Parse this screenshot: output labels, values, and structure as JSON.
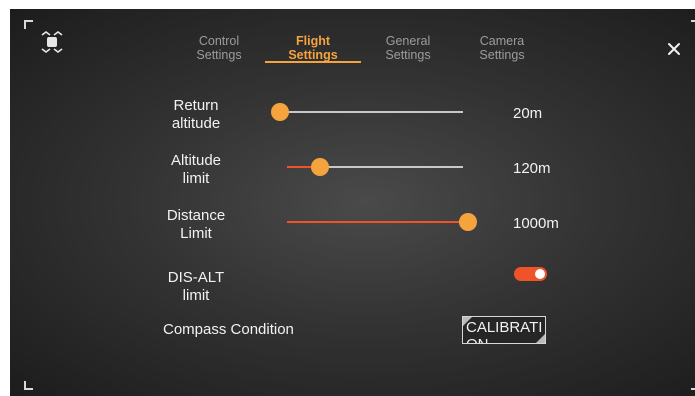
{
  "tabs": [
    {
      "line1": "Control",
      "line2": "Settings",
      "active": false
    },
    {
      "line1": "Flight",
      "line2": "Settings",
      "active": true
    },
    {
      "line1": "General",
      "line2": "Settings",
      "active": false
    },
    {
      "line1": "Camera",
      "line2": "Settings",
      "active": false
    }
  ],
  "icons": {
    "drone": "drone-icon",
    "close": "close-icon"
  },
  "settings": {
    "return_altitude": {
      "label_line1": "Return",
      "label_line2": "altitude",
      "value": "20m",
      "level": 0.0
    },
    "altitude_limit": {
      "label_line1": "Altitude",
      "label_line2": "limit",
      "value": "120m",
      "level": 0.19
    },
    "distance_limit": {
      "label_line1": "Distance",
      "label_line2": "Limit",
      "value": "1000m",
      "level": 1.0
    },
    "dis_alt_limit": {
      "label_line1": "DIS-ALT",
      "label_line2": "limit",
      "enabled": true
    },
    "compass": {
      "label": "Compass Condition",
      "button_label": "CALIBRATION"
    }
  },
  "colors": {
    "accent": "#f5a33d",
    "active_track": "#f0522a",
    "toggle_on": "#f0522a",
    "inactive_track": "#c8c8c8"
  }
}
